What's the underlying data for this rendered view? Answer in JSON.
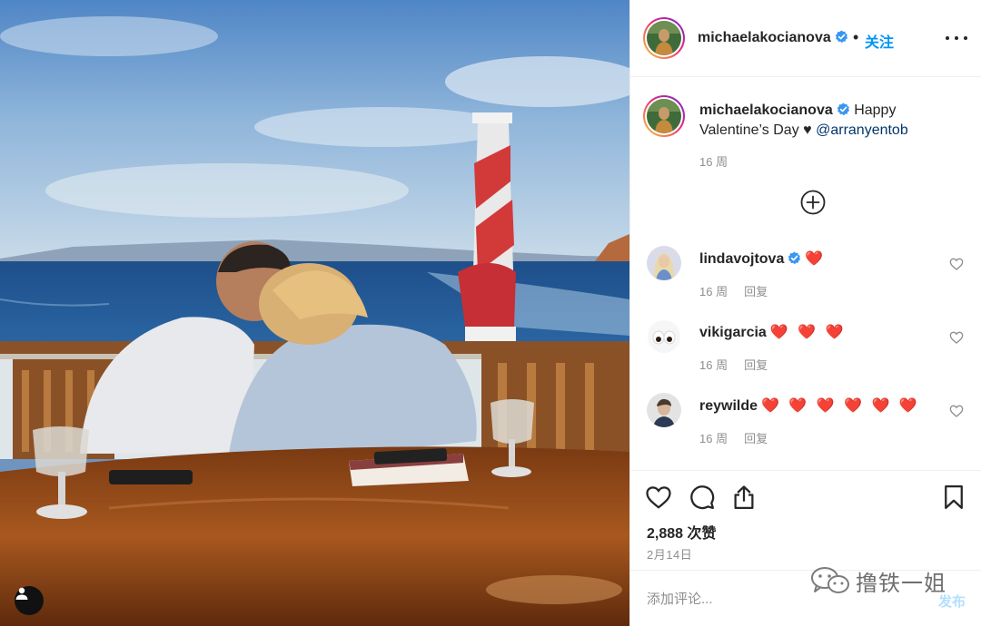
{
  "post": {
    "author": "michaelakocianova",
    "verified": true,
    "separator": "•",
    "follow_label": "关注",
    "caption_text": "Happy Valentine’s Day ♥ ",
    "caption_mention": "@arranyentob",
    "caption_time": "16 周"
  },
  "comments": [
    {
      "username": "lindavojtova",
      "verified": true,
      "text": "❤️",
      "time": "16 周",
      "reply_label": "回复",
      "avatar": "girl-avatar"
    },
    {
      "username": "vikigarcia",
      "verified": false,
      "text": "❤️ ❤️ ❤️",
      "time": "16 周",
      "reply_label": "回复",
      "avatar": "eyes-avatar"
    },
    {
      "username": "reywilde",
      "verified": false,
      "text": "❤️ ❤️ ❤️ ❤️ ❤️ ❤️",
      "time": "16 周",
      "reply_label": "回复",
      "avatar": "man-avatar"
    }
  ],
  "actions": {
    "icons": [
      "heart-icon",
      "comment-icon",
      "share-icon",
      "bookmark-icon"
    ],
    "likes": "2,888 次赞",
    "date": "2月14日"
  },
  "composer": {
    "placeholder": "添加评论...",
    "post_label": "发布"
  },
  "watermark": {
    "text": "撸铁一姐"
  },
  "colors": {
    "link_blue": "#0095f6",
    "mention_blue": "#00376b",
    "heart_red": "#e0245e",
    "muted_gray": "#8e8e8e"
  }
}
